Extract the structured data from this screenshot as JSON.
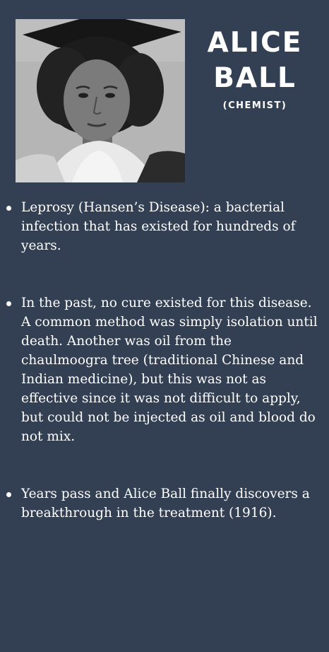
{
  "header": {
    "name_line1": "ALICE",
    "name_line2": "BALL",
    "role": "(CHEMIST)"
  },
  "portrait": {
    "icon": "portrait-photo"
  },
  "bullets": [
    {
      "text": "Leprosy (Hansen’s Disease): a bacterial infection that has existed for hundreds of years."
    },
    {
      "text": "In the past, no cure existed for this disease. A common method was simply isolation until death. Another was oil from the chaulmoogra tree (traditional Chinese and Indian medicine), but this was not as effective since it was not difficult to apply, but could not be injected as oil and blood do not mix."
    },
    {
      "text": "Years pass and Alice Ball finally discovers a breakthrough in the treatment (1916)."
    }
  ],
  "colors": {
    "background": "#333f52",
    "text": "#ffffff"
  }
}
